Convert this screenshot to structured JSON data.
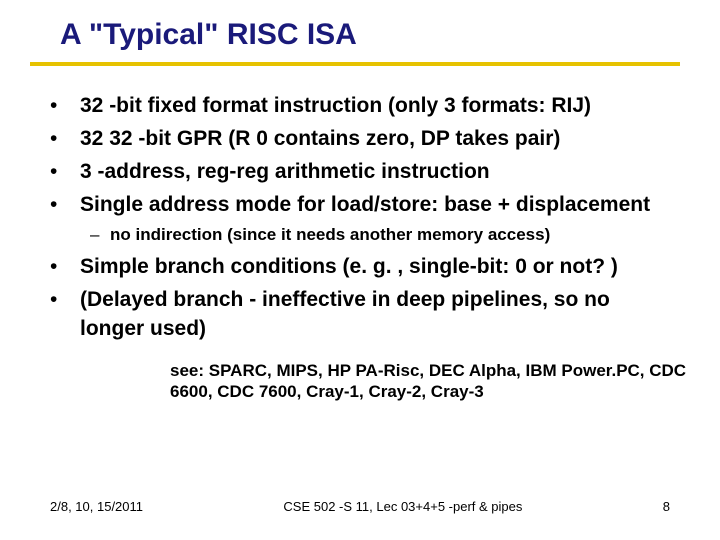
{
  "title": "A \"Typical\" RISC ISA",
  "bullets": {
    "b0": "32 -bit fixed format instruction (only 3 formats: RIJ)",
    "b1": "32 32 -bit GPR (R 0 contains zero, DP takes pair)",
    "b2": "3 -address, reg-reg arithmetic instruction",
    "b3": "Single address mode for load/store: base + displacement",
    "b3_sub": "no indirection (since it needs another memory access)",
    "b4": "Simple branch conditions (e. g. , single-bit: 0 or not? )",
    "b5": "(Delayed branch - ineffective in deep pipelines, so no longer used)"
  },
  "see": "see: SPARC, MIPS, HP PA-Risc, DEC Alpha, IBM Power.PC, CDC 6600, CDC 7600, Cray-1, Cray-2, Cray-3",
  "footer": {
    "date": "2/8, 10, 15/2011",
    "center": "CSE 502 -S 11, Lec 03+4+5 -perf & pipes",
    "page": "8"
  }
}
